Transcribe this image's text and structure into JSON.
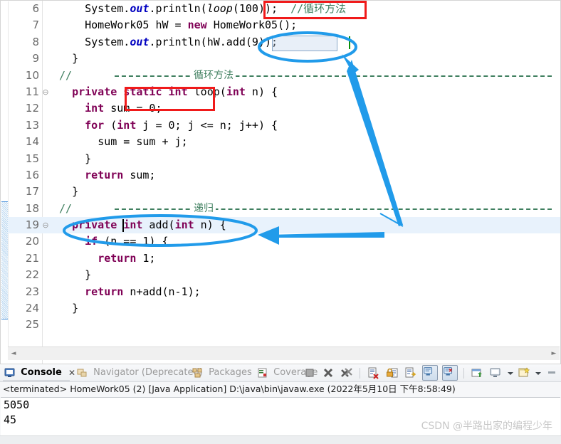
{
  "editor": {
    "lines": [
      {
        "num": "6",
        "fold": "",
        "indent": 4,
        "type": "code",
        "tokens": [
          {
            "t": "System.",
            "c": "pl"
          },
          {
            "t": "out",
            "c": "sfield"
          },
          {
            "t": ".println(",
            "c": "pl"
          },
          {
            "t": "loop",
            "c": "mth"
          },
          {
            "t": "(100));",
            "c": "pl"
          },
          {
            "t": "  //循环方法",
            "c": "cm"
          }
        ]
      },
      {
        "num": "7",
        "fold": "",
        "indent": 4,
        "type": "code",
        "tokens": [
          {
            "t": "HomeWork05 hW = ",
            "c": "pl"
          },
          {
            "t": "new",
            "c": "kw"
          },
          {
            "t": " HomeWork05();",
            "c": "pl"
          }
        ]
      },
      {
        "num": "8",
        "fold": "",
        "indent": 4,
        "type": "code",
        "tokens": [
          {
            "t": "System.",
            "c": "pl"
          },
          {
            "t": "out",
            "c": "sfield"
          },
          {
            "t": ".println(hW.add(9));",
            "c": "pl"
          }
        ]
      },
      {
        "num": "9",
        "fold": "",
        "indent": 2,
        "type": "code",
        "tokens": [
          {
            "t": "}",
            "c": "pl"
          }
        ]
      },
      {
        "num": "10",
        "fold": "",
        "indent": 0,
        "type": "separator",
        "label": "循环方法",
        "tokens": [
          {
            "t": "//",
            "c": "cm"
          }
        ]
      },
      {
        "num": "11",
        "fold": "⊖",
        "indent": 2,
        "type": "code",
        "tokens": [
          {
            "t": "private",
            "c": "kw"
          },
          {
            "t": " ",
            "c": "pl"
          },
          {
            "t": "static",
            "c": "kw"
          },
          {
            "t": " ",
            "c": "pl"
          },
          {
            "t": "int",
            "c": "kw"
          },
          {
            "t": " loop(",
            "c": "pl"
          },
          {
            "t": "int",
            "c": "kw"
          },
          {
            "t": " n) {",
            "c": "pl"
          }
        ]
      },
      {
        "num": "12",
        "fold": "",
        "indent": 4,
        "type": "code",
        "tokens": [
          {
            "t": "int",
            "c": "kw"
          },
          {
            "t": " sum = 0;",
            "c": "pl"
          }
        ]
      },
      {
        "num": "13",
        "fold": "",
        "indent": 4,
        "type": "code",
        "tokens": [
          {
            "t": "for",
            "c": "kw"
          },
          {
            "t": " (",
            "c": "pl"
          },
          {
            "t": "int",
            "c": "kw"
          },
          {
            "t": " j = 0; j <= n; j++) {",
            "c": "pl"
          }
        ]
      },
      {
        "num": "14",
        "fold": "",
        "indent": 6,
        "type": "code",
        "tokens": [
          {
            "t": "sum = sum + j;",
            "c": "pl"
          }
        ]
      },
      {
        "num": "15",
        "fold": "",
        "indent": 4,
        "type": "code",
        "tokens": [
          {
            "t": "}",
            "c": "pl"
          }
        ]
      },
      {
        "num": "16",
        "fold": "",
        "indent": 4,
        "type": "code",
        "tokens": [
          {
            "t": "return",
            "c": "kw"
          },
          {
            "t": " sum;",
            "c": "pl"
          }
        ]
      },
      {
        "num": "17",
        "fold": "",
        "indent": 2,
        "type": "code",
        "tokens": [
          {
            "t": "}",
            "c": "pl"
          }
        ]
      },
      {
        "num": "18",
        "fold": "",
        "indent": 0,
        "type": "separator",
        "label": "递归",
        "tokens": [
          {
            "t": "//",
            "c": "cm"
          }
        ]
      },
      {
        "num": "19",
        "fold": "⊖",
        "indent": 2,
        "type": "code",
        "highlight": true,
        "tokens": [
          {
            "t": "private",
            "c": "kw"
          },
          {
            "t": " ",
            "c": "pl"
          },
          {
            "t": "int",
            "c": "kw"
          },
          {
            "t": " add(",
            "c": "pl"
          },
          {
            "t": "int",
            "c": "kw"
          },
          {
            "t": " n) {",
            "c": "pl"
          }
        ]
      },
      {
        "num": "20",
        "fold": "",
        "indent": 4,
        "type": "code",
        "tokens": [
          {
            "t": "if",
            "c": "kw"
          },
          {
            "t": " (n == 1) {",
            "c": "pl"
          }
        ]
      },
      {
        "num": "21",
        "fold": "",
        "indent": 6,
        "type": "code",
        "tokens": [
          {
            "t": "return",
            "c": "kw"
          },
          {
            "t": " 1;",
            "c": "pl"
          }
        ]
      },
      {
        "num": "22",
        "fold": "",
        "indent": 4,
        "type": "code",
        "tokens": [
          {
            "t": "}",
            "c": "pl"
          }
        ]
      },
      {
        "num": "23",
        "fold": "",
        "indent": 4,
        "type": "code",
        "tokens": [
          {
            "t": "return",
            "c": "kw"
          },
          {
            "t": " n+add(n-1);",
            "c": "pl"
          }
        ]
      },
      {
        "num": "24",
        "fold": "",
        "indent": 2,
        "type": "code",
        "tokens": [
          {
            "t": "}",
            "c": "pl"
          }
        ]
      },
      {
        "num": "25",
        "fold": "",
        "indent": 0,
        "type": "code",
        "tokens": [
          {
            "t": "",
            "c": "pl"
          }
        ]
      }
    ],
    "scroll_left_arrow": "◄",
    "scroll_right_arrow": "►"
  },
  "annotations": {
    "red_box_1_target": "(loop(100));",
    "red_box_2_target": "static int",
    "blue_ellipse_1_target": "hW.add(9))",
    "blue_ellipse_2_target": "private int add(int n)",
    "arrow_color": "#219bea",
    "red_color": "#f01a1a"
  },
  "console": {
    "tabs": [
      {
        "label": "Console",
        "icon": "console-icon",
        "active": true,
        "closable": true
      },
      {
        "label": "Navigator (Deprecated)",
        "icon": "navigator-icon",
        "active": false,
        "closable": false
      },
      {
        "label": "Packages",
        "icon": "packages-icon",
        "active": false,
        "closable": false
      },
      {
        "label": "Coverage",
        "icon": "coverage-icon",
        "active": false,
        "closable": false
      }
    ],
    "close_glyph": "✕",
    "toolbar": [
      {
        "name": "terminate-button",
        "icon": "stop-square-icon"
      },
      {
        "name": "remove-launch-button",
        "icon": "x-icon"
      },
      {
        "name": "remove-all-terminated-button",
        "icon": "double-x-icon"
      },
      {
        "name": "clear-console-button",
        "icon": "clear-console-icon"
      },
      {
        "name": "scroll-lock-button",
        "icon": "lock-icon"
      },
      {
        "name": "word-wrap-button",
        "icon": "wrap-icon"
      },
      {
        "name": "show-console-on-output-button",
        "icon": "console-out-icon"
      },
      {
        "name": "show-console-on-error-button",
        "icon": "console-err-icon"
      },
      {
        "name": "pin-console-button",
        "icon": "pin-icon"
      },
      {
        "name": "display-selected-console-button",
        "icon": "display-console-icon"
      },
      {
        "name": "open-console-button",
        "icon": "new-console-icon"
      },
      {
        "name": "minimize-button",
        "icon": "minimize-icon"
      }
    ],
    "status_line": "<terminated> HomeWork05 (2) [Java Application] D:\\java\\bin\\javaw.exe (2022年5月10日 下午8:58:49)",
    "output": [
      "5050",
      "45"
    ]
  },
  "watermark": "CSDN @半路出家的编程少年"
}
